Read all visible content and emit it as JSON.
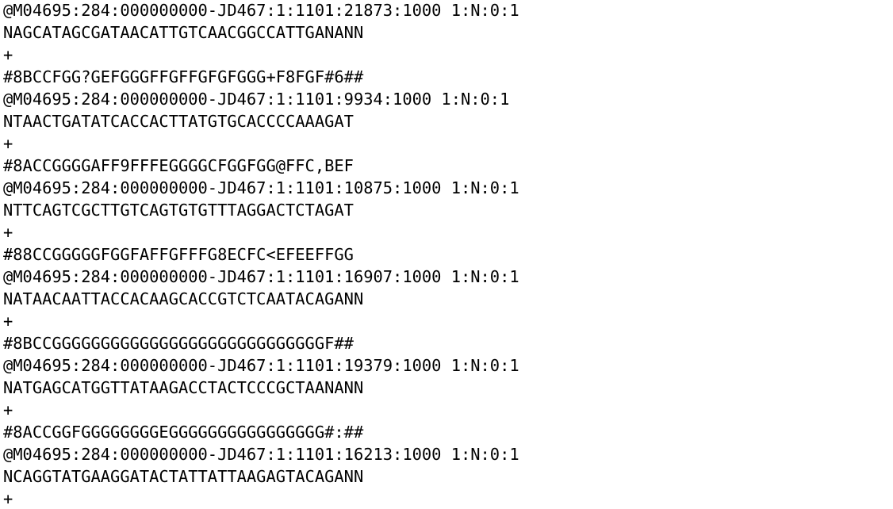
{
  "lines": [
    "@M04695:284:000000000-JD467:1:1101:21873:1000 1:N:0:1",
    "NAGCATAGCGATAACATTGTCAACGGCCATTGANANN",
    "+",
    "#8BCCFGG?GEFGGGFFGFFGFGFGGG+F8FGF#6##",
    "@M04695:284:000000000-JD467:1:1101:9934:1000 1:N:0:1",
    "NTAACTGATATCACCACTTATGTGCACCCCAAAGAT",
    "+",
    "#8ACCGGGGAFF9FFFEGGGGCFGGFGG@FFC,BEF",
    "@M04695:284:000000000-JD467:1:1101:10875:1000 1:N:0:1",
    "NTTCAGTCGCTTGTCAGTGTGTTTAGGACTCTAGAT",
    "+",
    "#88CCGGGGGFGGFAFFGFFFG8ECFC<EFEEFFGG",
    "@M04695:284:000000000-JD467:1:1101:16907:1000 1:N:0:1",
    "NATAACAATTACCACAAGCACCGTCTCAATACAGANN",
    "+",
    "#8BCCGGGGGGGGGGGGGGGGGGGGGGGGGGGGF##",
    "@M04695:284:000000000-JD467:1:1101:19379:1000 1:N:0:1",
    "NATGAGCATGGTTATAAGACCTACTCCCGCTAANANN",
    "+",
    "#8ACCGGFGGGGGGGGEGGGGGGGGGGGGGGGG#:##",
    "@M04695:284:000000000-JD467:1:1101:16213:1000 1:N:0:1",
    "NCAGGTATGAAGGATACTATTATTAAGAGTACAGANN",
    "+"
  ]
}
